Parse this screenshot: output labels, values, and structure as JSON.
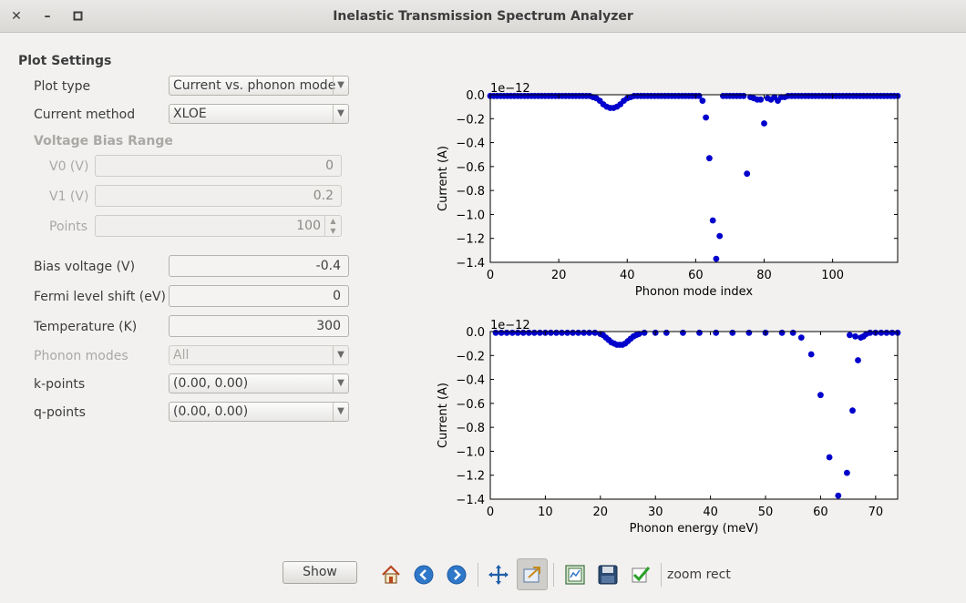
{
  "window": {
    "title": "Inelastic Transmission Spectrum Analyzer",
    "close": "✕",
    "minimize": "–",
    "maximize": "▫"
  },
  "form": {
    "section_title": "Plot Settings",
    "plot_type": {
      "label": "Plot type",
      "value": "Current vs. phonon mode"
    },
    "current_method": {
      "label": "Current method",
      "value": "XLOE"
    },
    "voltage_bias_range": {
      "label": "Voltage Bias Range",
      "v0": {
        "label": "V0 (V)",
        "value": "0"
      },
      "v1": {
        "label": "V1 (V)",
        "value": "0.2"
      },
      "points": {
        "label": "Points",
        "value": "100"
      }
    },
    "bias_voltage": {
      "label": "Bias voltage (V)",
      "value": "-0.4"
    },
    "fermi_shift": {
      "label": "Fermi level shift (eV)",
      "value": "0"
    },
    "temperature": {
      "label": "Temperature (K)",
      "value": "300"
    },
    "phonon_modes": {
      "label": "Phonon modes",
      "value": "All"
    },
    "k_points": {
      "label": "k-points",
      "value": "(0.00, 0.00)"
    },
    "q_points": {
      "label": "q-points",
      "value": "(0.00, 0.00)"
    }
  },
  "toolbar": {
    "show_label": "Show",
    "status": "zoom rect",
    "icons": [
      "home-icon",
      "back-arrow-icon",
      "forward-arrow-icon",
      "pan-icon",
      "zoom-rect-icon",
      "subplots-config-icon",
      "save-icon",
      "check-icon"
    ]
  },
  "colors": {
    "marker": "#0000cc",
    "window_bg": "#f2f1f0"
  },
  "chart_data": [
    {
      "type": "scatter",
      "xlabel": "Phonon mode index",
      "ylabel": "Current (A)",
      "offset_label": "1e−12",
      "xlim": [
        0,
        119
      ],
      "ylim": [
        -1.4,
        0.0
      ],
      "xticks": [
        0,
        20,
        40,
        60,
        80,
        100
      ],
      "yticks": [
        0.0,
        -0.2,
        -0.4,
        -0.6,
        -0.8,
        -1.0,
        -1.2,
        -1.4
      ],
      "ytick_labels": [
        "0.0",
        "−0.2",
        "−0.4",
        "−0.6",
        "−0.8",
        "−1.0",
        "−1.2",
        "−1.4"
      ],
      "x": [
        0,
        1,
        2,
        3,
        4,
        5,
        6,
        7,
        8,
        9,
        10,
        11,
        12,
        13,
        14,
        15,
        16,
        17,
        18,
        19,
        20,
        21,
        22,
        23,
        24,
        25,
        26,
        27,
        28,
        29,
        30,
        31,
        32,
        33,
        34,
        35,
        36,
        37,
        38,
        39,
        40,
        41,
        42,
        43,
        44,
        45,
        46,
        47,
        48,
        49,
        50,
        51,
        52,
        53,
        54,
        55,
        56,
        57,
        58,
        59,
        60,
        61,
        62,
        63,
        64,
        65,
        66,
        67,
        68,
        69,
        70,
        71,
        72,
        73,
        74,
        75,
        76,
        77,
        78,
        79,
        80,
        81,
        82,
        83,
        84,
        85,
        86,
        87,
        88,
        89,
        90,
        91,
        92,
        93,
        94,
        95,
        96,
        97,
        98,
        99,
        100,
        101,
        102,
        103,
        104,
        105,
        106,
        107,
        108,
        109,
        110,
        111,
        112,
        113,
        114,
        115,
        116,
        117,
        118,
        119
      ],
      "y": [
        -0.01,
        -0.01,
        -0.01,
        -0.01,
        -0.01,
        -0.01,
        -0.01,
        -0.01,
        -0.01,
        -0.01,
        -0.01,
        -0.01,
        -0.01,
        -0.01,
        -0.01,
        -0.01,
        -0.01,
        -0.01,
        -0.01,
        -0.01,
        -0.01,
        -0.01,
        -0.01,
        -0.01,
        -0.01,
        -0.01,
        -0.01,
        -0.01,
        -0.01,
        -0.01,
        -0.02,
        -0.03,
        -0.05,
        -0.08,
        -0.1,
        -0.11,
        -0.11,
        -0.1,
        -0.08,
        -0.05,
        -0.03,
        -0.02,
        -0.01,
        -0.01,
        -0.01,
        -0.01,
        -0.01,
        -0.01,
        -0.01,
        -0.01,
        -0.01,
        -0.01,
        -0.01,
        -0.01,
        -0.01,
        -0.01,
        -0.01,
        -0.01,
        -0.01,
        -0.01,
        -0.01,
        -0.01,
        -0.05,
        -0.19,
        -0.53,
        -1.05,
        -1.37,
        -1.18,
        -0.01,
        -0.01,
        -0.01,
        -0.01,
        -0.01,
        -0.01,
        -0.01,
        -0.66,
        -0.02,
        -0.03,
        -0.04,
        -0.04,
        -0.24,
        -0.03,
        -0.04,
        -0.02,
        -0.05,
        -0.02,
        -0.02,
        -0.01,
        -0.01,
        -0.01,
        -0.01,
        -0.01,
        -0.01,
        -0.01,
        -0.01,
        -0.01,
        -0.01,
        -0.01,
        -0.01,
        -0.01,
        -0.01,
        -0.01,
        -0.01,
        -0.01,
        -0.01,
        -0.01,
        -0.01,
        -0.01,
        -0.01,
        -0.01,
        -0.01,
        -0.01,
        -0.01,
        -0.01,
        -0.01,
        -0.01,
        -0.01,
        -0.01,
        -0.01,
        -0.01
      ]
    },
    {
      "type": "scatter",
      "xlabel": "Phonon energy (meV)",
      "ylabel": "Current (A)",
      "offset_label": "1e−12",
      "xlim": [
        0,
        74
      ],
      "ylim": [
        -1.4,
        0.0
      ],
      "xticks": [
        0,
        10,
        20,
        30,
        40,
        50,
        60,
        70
      ],
      "yticks": [
        0.0,
        -0.2,
        -0.4,
        -0.6,
        -0.8,
        -1.0,
        -1.2,
        -1.4
      ],
      "ytick_labels": [
        "0.0",
        "−0.2",
        "−0.4",
        "−0.6",
        "−0.8",
        "−1.0",
        "−1.2",
        "−1.4"
      ],
      "x": [
        1,
        2,
        3,
        4,
        5,
        6,
        7,
        8,
        9,
        10,
        11,
        12,
        13,
        14,
        15,
        16,
        17,
        18,
        19,
        20,
        20.5,
        21,
        21.5,
        22,
        22.5,
        23,
        23.5,
        24,
        24.5,
        25,
        25.5,
        26,
        26.5,
        27,
        28,
        30,
        32,
        35,
        38,
        41,
        44,
        47,
        50,
        53,
        55,
        56.5,
        58.3,
        60,
        61.6,
        63.2,
        64.8,
        65.3,
        65.8,
        66.3,
        66.8,
        67.3,
        67.8,
        68.3,
        69,
        70,
        71,
        72,
        73,
        74
      ],
      "y": [
        -0.01,
        -0.01,
        -0.01,
        -0.01,
        -0.01,
        -0.01,
        -0.01,
        -0.01,
        -0.01,
        -0.01,
        -0.01,
        -0.01,
        -0.01,
        -0.01,
        -0.01,
        -0.01,
        -0.01,
        -0.01,
        -0.01,
        -0.02,
        -0.03,
        -0.05,
        -0.07,
        -0.09,
        -0.1,
        -0.11,
        -0.11,
        -0.11,
        -0.1,
        -0.08,
        -0.06,
        -0.04,
        -0.03,
        -0.02,
        -0.01,
        -0.01,
        -0.01,
        -0.01,
        -0.01,
        -0.01,
        -0.01,
        -0.01,
        -0.01,
        -0.01,
        -0.01,
        -0.05,
        -0.19,
        -0.53,
        -1.05,
        -1.37,
        -1.18,
        -0.03,
        -0.66,
        -0.04,
        -0.24,
        -0.05,
        -0.04,
        -0.02,
        -0.01,
        -0.01,
        -0.01,
        -0.01,
        -0.01,
        -0.01
      ]
    }
  ]
}
